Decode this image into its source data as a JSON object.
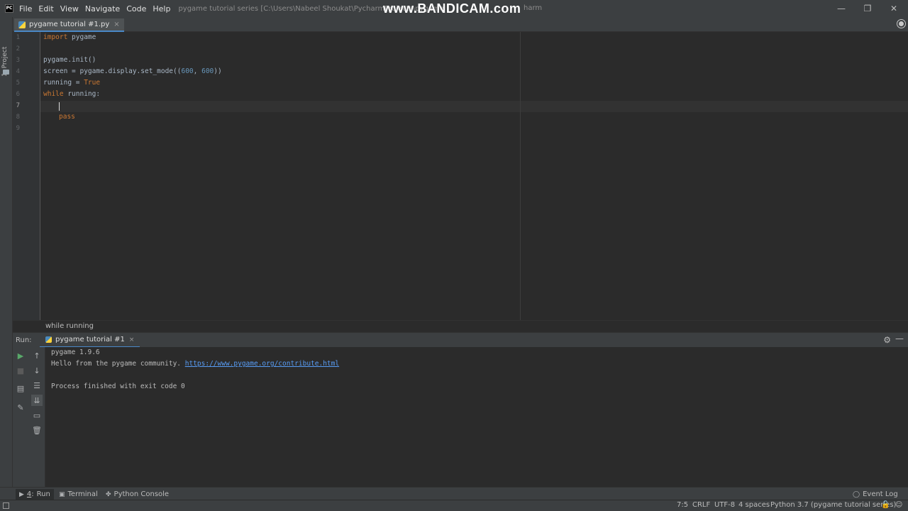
{
  "app": {
    "logo_text": "PC",
    "window_title": "pygame tutorial series [C:\\Users\\Nabeel Shoukat\\PycharmProjects\\pygame",
    "watermark": "www.BANDICAM.com",
    "watermark_tail": "harm"
  },
  "menu": [
    {
      "label": "File"
    },
    {
      "label": "Edit"
    },
    {
      "label": "View"
    },
    {
      "label": "Navigate"
    },
    {
      "label": "Code"
    },
    {
      "label": "Help"
    }
  ],
  "window_controls": {
    "minimize": "—",
    "restore": "❐",
    "close": "✕"
  },
  "left_strip": {
    "project_tab": "1: Project"
  },
  "editor": {
    "tab_label": "pygame tutorial #1.py",
    "tab_close": "×",
    "line_numbers": [
      "1",
      "2",
      "3",
      "4",
      "5",
      "6",
      "7",
      "8",
      "9"
    ],
    "code": {
      "l1_kw": "import",
      "l1_rest": " pygame",
      "l4": "pygame.init()",
      "l5_a": "screen = pygame.display.set_mode((",
      "l5_n1": "600",
      "l5_sep": ", ",
      "l5_n2": "600",
      "l5_end": "))",
      "l6_a": "running = ",
      "l6_kw": "True",
      "l7_kw": "while",
      "l7_rest": " running:",
      "l9_kw": "pass"
    },
    "breadcrumb": "while running"
  },
  "run_panel": {
    "label": "Run:",
    "tab_label": "pygame tutorial #1",
    "tab_close": "×",
    "settings_icon": "⚙",
    "minimize_icon": "—",
    "console": {
      "line1": "pygame 1.9.6",
      "line2_text": "Hello from the pygame community. ",
      "line2_link": "https://www.pygame.org/contribute.html",
      "line4": "Process finished with exit code 0"
    }
  },
  "tool_windows": [
    {
      "label": "Run",
      "number": "4"
    },
    {
      "label": "Terminal"
    },
    {
      "label": "Python Console"
    }
  ],
  "event_log": "Event Log",
  "status_bar": {
    "position": "7:5",
    "line_separator": "CRLF",
    "encoding": "UTF-8",
    "indent": "4 spaces",
    "interpreter": "Python 3.7 (pygame tutorial series)"
  },
  "colors": {
    "background": "#2b2b2b",
    "panel": "#3c3f41",
    "keyword": "#cc7832",
    "number": "#6897bb",
    "link": "#589df6",
    "accent": "#4a88c7"
  }
}
